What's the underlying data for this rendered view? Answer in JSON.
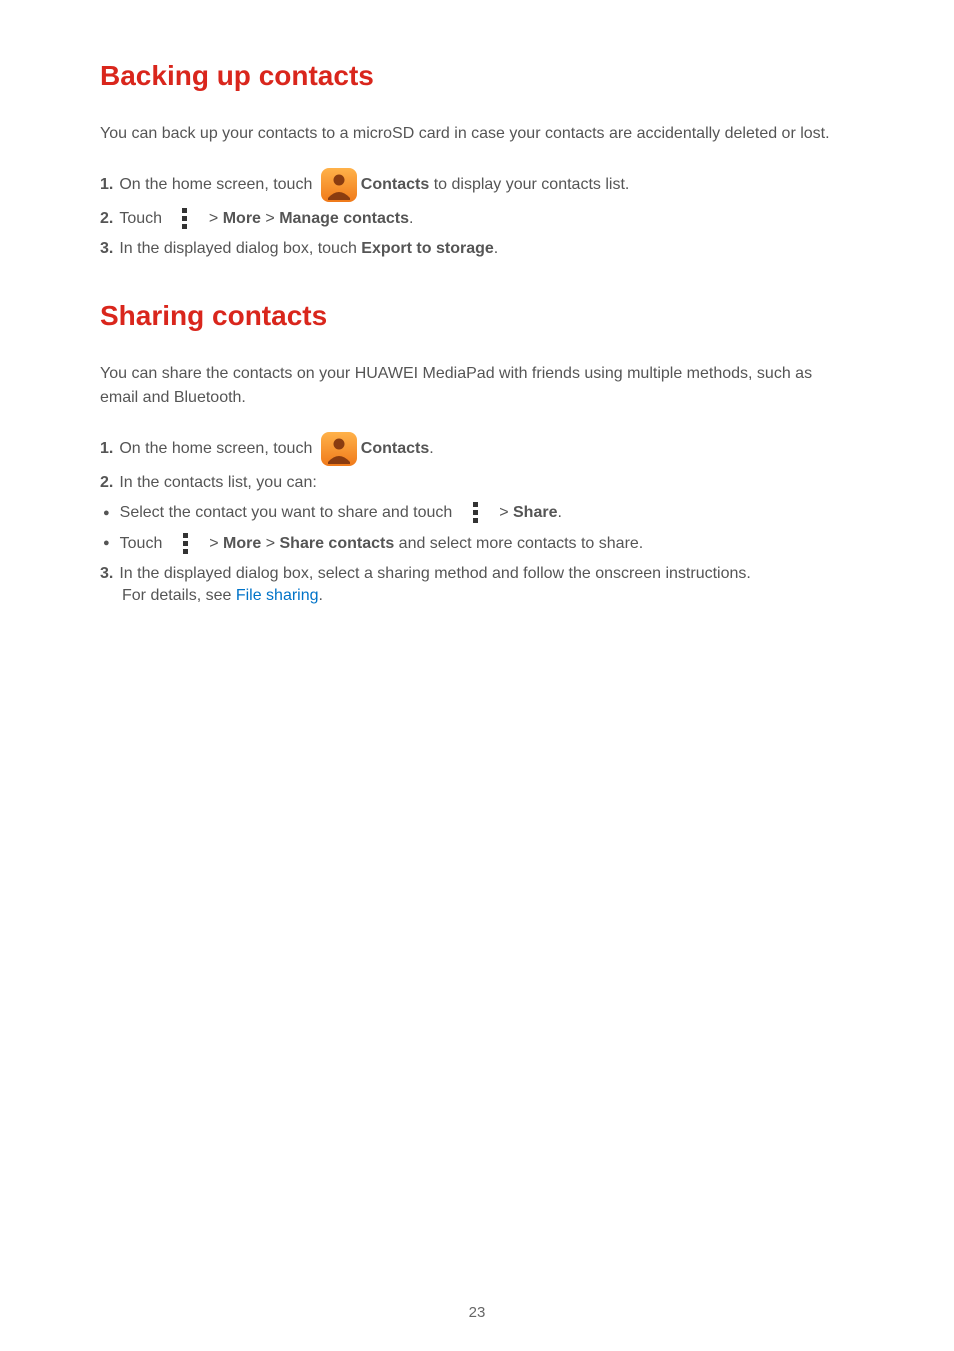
{
  "section1": {
    "heading": "Backing up contacts",
    "intro": "You can back up your contacts to a microSD card in case your contacts are accidentally deleted or lost.",
    "step1_a": "On the home screen, touch ",
    "step1_b": "Contacts",
    "step1_c": " to display your contacts list.",
    "step2_a": "Touch ",
    "step2_b": " > ",
    "step2_c": "More",
    "step2_d": " > ",
    "step2_e": "Manage contacts",
    "step2_f": ".",
    "step3_a": "In the displayed dialog box, touch ",
    "step3_b": "Export to storage",
    "step3_c": "."
  },
  "section2": {
    "heading": "Sharing contacts",
    "intro": "You can share the contacts on your HUAWEI MediaPad with friends using multiple methods, such as email and Bluetooth.",
    "s1_a": "On the home screen, touch ",
    "s1_b": "Contacts",
    "s1_c": ".",
    "s2_a": "In the contacts list, you can:",
    "b1_a": "Select the contact you want to share and touch ",
    "b1_b": " > ",
    "b1_c": "Share",
    "b1_d": ".",
    "b2_a": "Touch ",
    "b2_b": " > ",
    "b2_c": "More",
    "b2_d": " > ",
    "b2_e": "Share contacts",
    "b2_f": " and select more contacts to share.",
    "s3_a": "In the displayed dialog box, select a sharing method and follow the onscreen instructions. ",
    "s3_b": "For details, see ",
    "s3_c": "File sharing",
    "s3_d": "."
  },
  "nums": {
    "n1": "1. ",
    "n2": "2. ",
    "n3": "3. "
  },
  "bullet": "●",
  "page": "23"
}
